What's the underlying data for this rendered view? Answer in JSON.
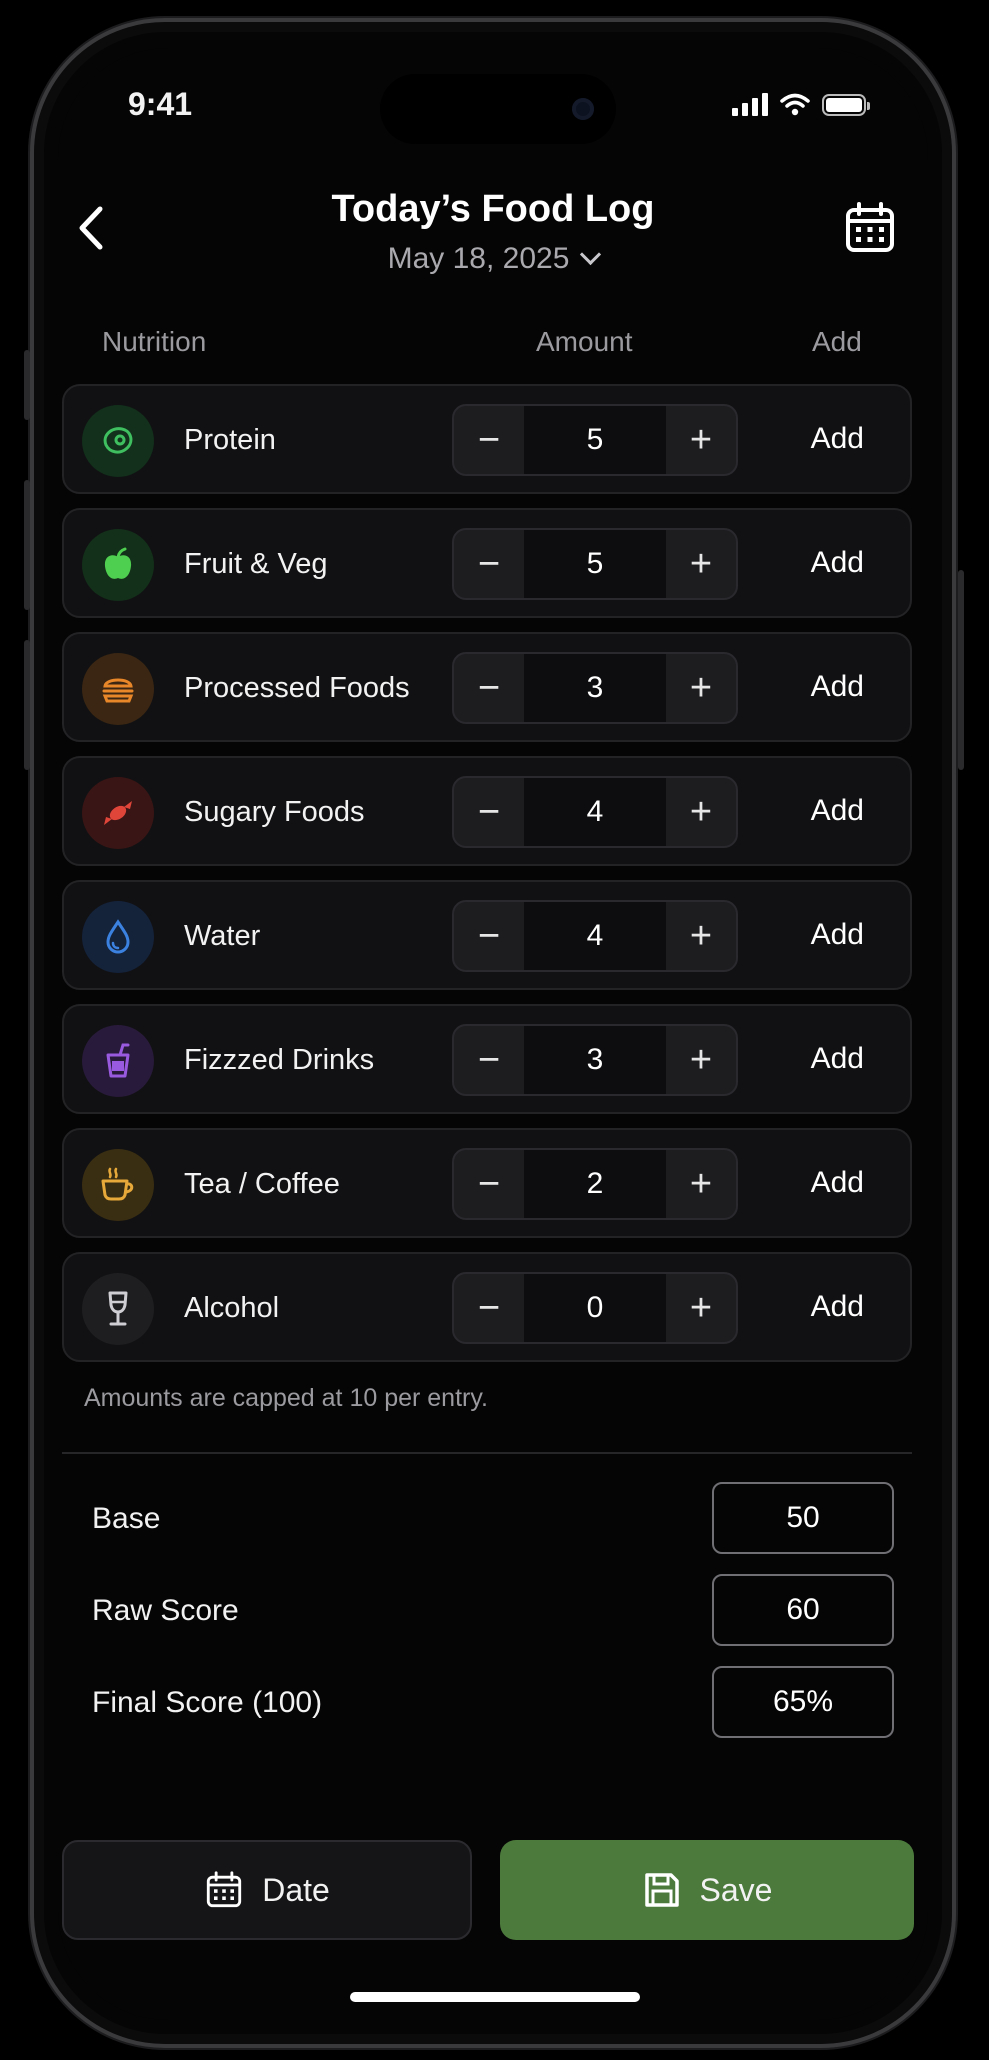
{
  "status_bar": {
    "time": "9:41"
  },
  "header": {
    "title": "Today’s Food Log",
    "date": "May 18, 2025"
  },
  "columns": {
    "nutrition": "Nutrition",
    "amount": "Amount",
    "add": "Add"
  },
  "rows": [
    {
      "label": "Protein",
      "value": "5",
      "add": "Add",
      "icon": "steak-icon",
      "color": "#3fbf5f"
    },
    {
      "label": "Fruit & Veg",
      "value": "5",
      "add": "Add",
      "icon": "apple-icon",
      "color": "#4fcf4f"
    },
    {
      "label": "Processed Foods",
      "value": "3",
      "add": "Add",
      "icon": "burger-icon",
      "color": "#e8862a"
    },
    {
      "label": "Sugary Foods",
      "value": "4",
      "add": "Add",
      "icon": "candy-icon",
      "color": "#e0453a"
    },
    {
      "label": "Water",
      "value": "4",
      "add": "Add",
      "icon": "water-drop-icon",
      "color": "#3b82e0"
    },
    {
      "label": "Fizzzed Drinks",
      "value": "3",
      "add": "Add",
      "icon": "soda-cup-icon",
      "color": "#9a5ae0"
    },
    {
      "label": "Tea / Coffee",
      "value": "2",
      "add": "Add",
      "icon": "coffee-cup-icon",
      "color": "#e6a93a"
    },
    {
      "label": "Alcohol",
      "value": "0",
      "add": "Add",
      "icon": "wine-glass-icon",
      "color": "#a0a0a4"
    }
  ],
  "note": "Amounts are capped at 10 per entry.",
  "scores": {
    "base_label": "Base",
    "base_value": "50",
    "raw_label": "Raw Score",
    "raw_value": "60",
    "final_label": "Final Score (100)",
    "final_value": "65%"
  },
  "actions": {
    "date_label": "Date",
    "save_label": "Save"
  },
  "colors": {
    "accent_green": "#4c7a3c",
    "row_bg": "#111113"
  }
}
